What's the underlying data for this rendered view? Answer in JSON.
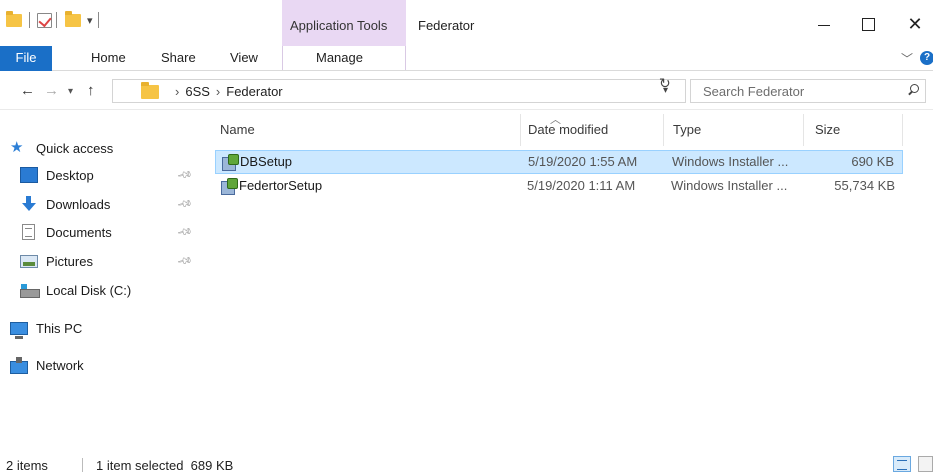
{
  "window": {
    "title": "Federator",
    "context_tab_group": "Application Tools"
  },
  "ribbon": {
    "tabs": [
      {
        "label": "File"
      },
      {
        "label": "Home"
      },
      {
        "label": "Share"
      },
      {
        "label": "View"
      },
      {
        "label": "Manage"
      }
    ]
  },
  "address": {
    "breadcrumbs": [
      "6SS",
      "Federator"
    ],
    "search_placeholder": "Search Federator"
  },
  "sidebar": {
    "items": [
      {
        "label": "Quick access",
        "icon": "star-icon"
      },
      {
        "label": "Desktop",
        "icon": "desktop-icon",
        "pinned": true
      },
      {
        "label": "Downloads",
        "icon": "download-icon",
        "pinned": true
      },
      {
        "label": "Documents",
        "icon": "documents-icon",
        "pinned": true
      },
      {
        "label": "Pictures",
        "icon": "pictures-icon",
        "pinned": true
      },
      {
        "label": "Local Disk (C:)",
        "icon": "disk-icon"
      },
      {
        "label": "This PC",
        "icon": "pc-icon"
      },
      {
        "label": "Network",
        "icon": "network-icon"
      }
    ]
  },
  "filelist": {
    "columns": [
      "Name",
      "Date modified",
      "Type",
      "Size"
    ],
    "rows": [
      {
        "name": "DBSetup",
        "date": "5/19/2020 1:55 AM",
        "type": "Windows Installer ...",
        "size": "690 KB",
        "selected": true
      },
      {
        "name": "FedertorSetup",
        "date": "5/19/2020 1:11 AM",
        "type": "Windows Installer ...",
        "size": "55,734 KB",
        "selected": false
      }
    ]
  },
  "status": {
    "item_count": "2 items",
    "selection": "1 item selected  689 KB"
  },
  "colors": {
    "accent": "#1a6fc7",
    "context_tab": "#e9d8f3",
    "selection": "#cce8ff"
  }
}
